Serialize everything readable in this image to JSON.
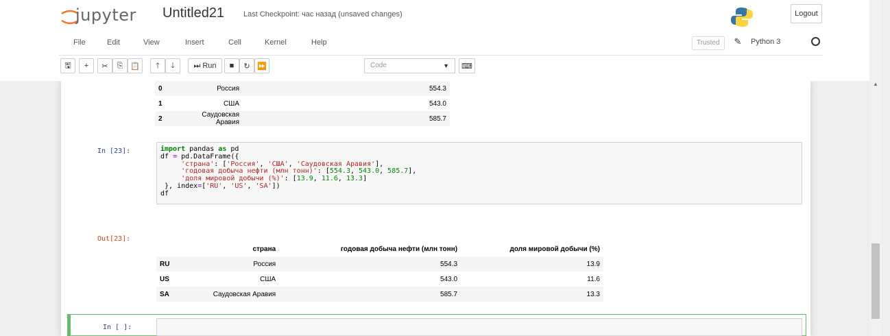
{
  "header": {
    "logo_text": "jupyter",
    "notebook_name": "Untitled21",
    "checkpoint": "Last Checkpoint: час назад  (unsaved changes)",
    "logout_label": "Logout"
  },
  "menu": {
    "items": [
      "File",
      "Edit",
      "View",
      "Insert",
      "Cell",
      "Kernel",
      "Help"
    ],
    "trusted_label": "Trusted",
    "kernel_name": "Python 3"
  },
  "toolbar": {
    "run_label": "Run",
    "cell_type": "Code"
  },
  "cells": {
    "prev_output": {
      "rows": [
        {
          "index": "0",
          "country": "Россия",
          "value": "554.3"
        },
        {
          "index": "1",
          "country": "США",
          "value": "543.0"
        },
        {
          "index": "2",
          "country": "Саудовская Аравия",
          "value": "585.7"
        }
      ]
    },
    "cell23": {
      "in_prompt": "In [23]:",
      "out_prompt": "Out[23]:",
      "headers": [
        "страна",
        "годовая добыча нефти (млн тонн)",
        "доля мировой добычи (%)"
      ],
      "rows": [
        {
          "index": "RU",
          "country": "Россия",
          "oil": "554.3",
          "share": "13.9"
        },
        {
          "index": "US",
          "country": "США",
          "oil": "543.0",
          "share": "11.6"
        },
        {
          "index": "SA",
          "country": "Саудовская Аравия",
          "oil": "585.7",
          "share": "13.3"
        }
      ]
    },
    "empty_cell": {
      "in_prompt": "In [ ]:"
    }
  },
  "colors": {
    "in_prompt": "#303f9f",
    "out_prompt": "#d84315",
    "active_border": "#66bb6a"
  }
}
